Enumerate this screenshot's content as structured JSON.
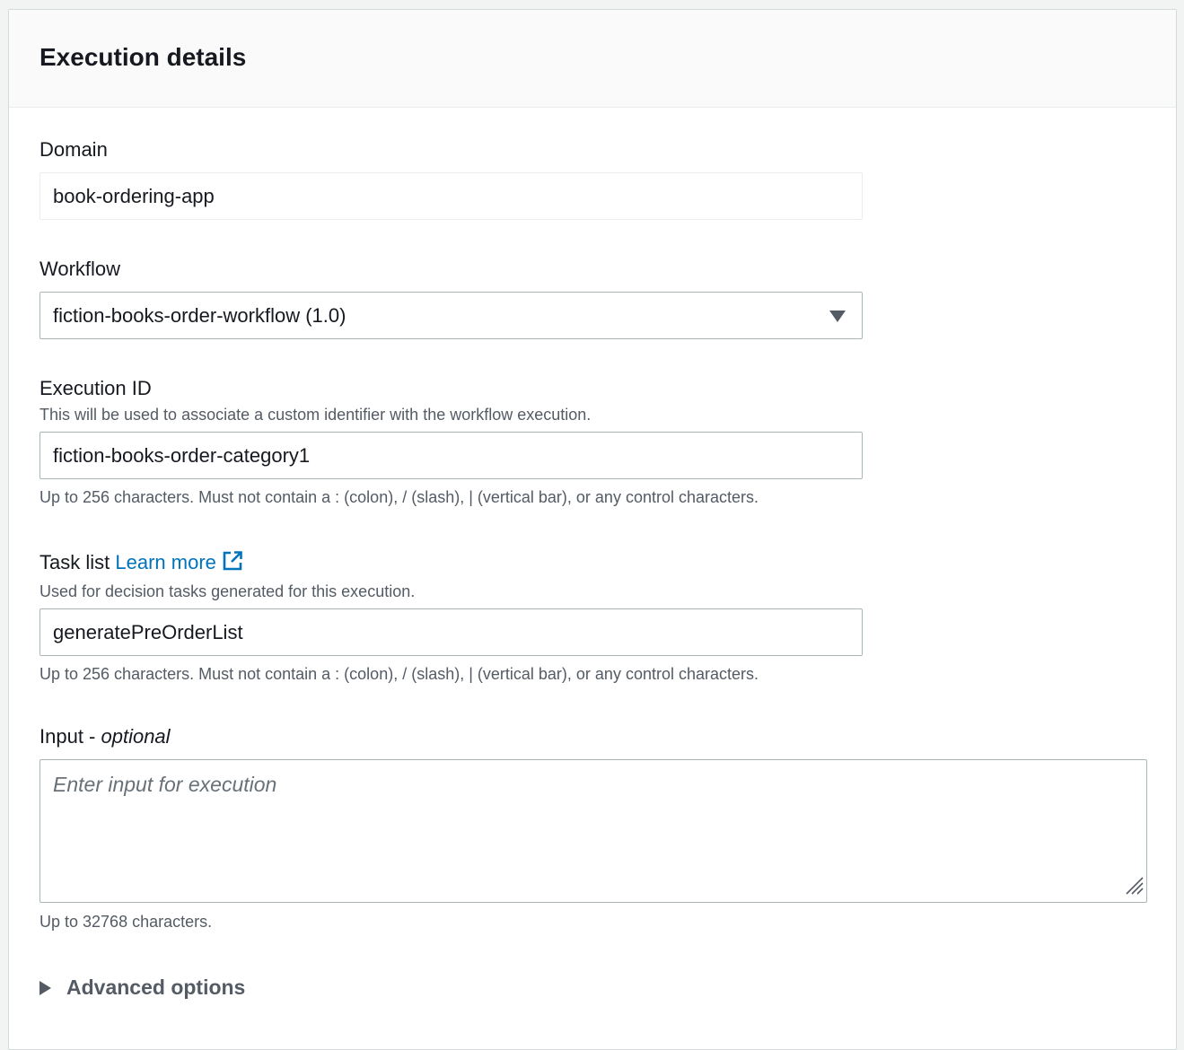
{
  "panel": {
    "title": "Execution details"
  },
  "domain": {
    "label": "Domain",
    "value": "book-ordering-app"
  },
  "workflow": {
    "label": "Workflow",
    "selected": "fiction-books-order-workflow (1.0)"
  },
  "execution_id": {
    "label": "Execution ID",
    "description": "This will be used to associate a custom identifier with the workflow execution.",
    "value": "fiction-books-order-category1",
    "constraint": "Up to 256 characters. Must not contain a : (colon), / (slash), | (vertical bar), or any control characters."
  },
  "task_list": {
    "label": "Task list",
    "link_text": "Learn more",
    "description": "Used for decision tasks generated for this execution.",
    "value": "generatePreOrderList",
    "constraint": "Up to 256 characters. Must not contain a : (colon), / (slash), | (vertical bar), or any control characters."
  },
  "input": {
    "label": "Input - ",
    "label_optional": "optional",
    "placeholder": "Enter input for execution",
    "constraint": "Up to 32768 characters."
  },
  "advanced_options": {
    "label": "Advanced options"
  },
  "icons": {
    "external_link": "external-link-icon",
    "select_caret": "caret-down-icon",
    "expand": "caret-right-icon",
    "resize": "resize-handle-icon"
  },
  "colors": {
    "link": "#0073bb",
    "text": "#16191f",
    "secondary_text": "#545b64",
    "input_border": "#aab7b8",
    "header_bg": "#fafafa"
  }
}
